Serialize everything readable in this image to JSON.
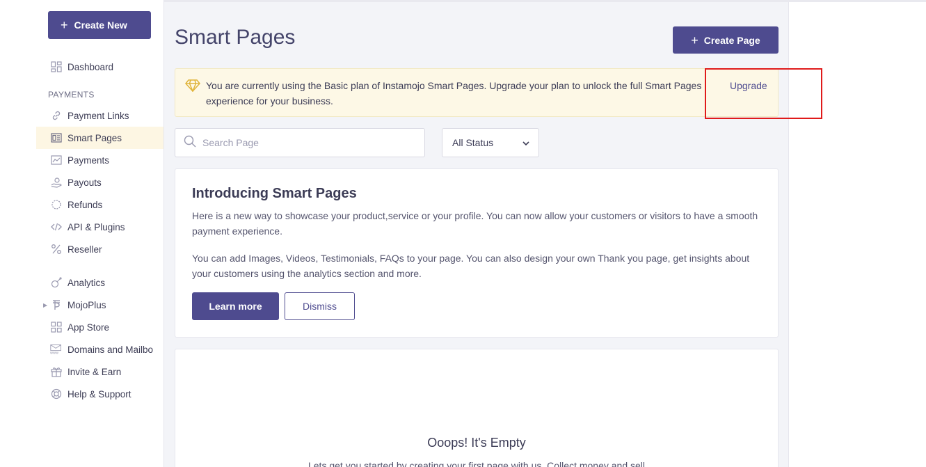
{
  "sidebar": {
    "create_new": "Create New",
    "section_payments": "PAYMENTS",
    "items": [
      {
        "label": "Dashboard",
        "icon": "grid-icon"
      },
      {
        "label": "Payment Links",
        "icon": "link-icon"
      },
      {
        "label": "Smart Pages",
        "icon": "page-icon",
        "active": true
      },
      {
        "label": "Payments",
        "icon": "chart-icon"
      },
      {
        "label": "Payouts",
        "icon": "payouts-icon"
      },
      {
        "label": "Refunds",
        "icon": "refund-icon"
      },
      {
        "label": "API & Plugins",
        "icon": "code-icon"
      },
      {
        "label": "Reseller",
        "icon": "percent-icon"
      },
      {
        "label": "Analytics",
        "icon": "analytics-icon"
      },
      {
        "label": "MojoPlus",
        "icon": "mojoplus-icon"
      },
      {
        "label": "App Store",
        "icon": "apps-icon"
      },
      {
        "label": "Domains and Mailbo",
        "icon": "mail-icon"
      },
      {
        "label": "Invite & Earn",
        "icon": "gift-icon"
      },
      {
        "label": "Help & Support",
        "icon": "support-icon"
      }
    ]
  },
  "main": {
    "title": "Smart Pages",
    "create_page": "Create Page",
    "banner": {
      "text": "You are currently using the Basic plan of Instamojo Smart Pages. Upgrade your plan to unlock the full Smart Pages experience for your business.",
      "link": "Upgrade"
    },
    "search": {
      "placeholder": "Search Page",
      "value": ""
    },
    "status_filter": {
      "selected": "All Status"
    },
    "intro": {
      "title": "Introducing Smart Pages",
      "p1": "Here is a new way to showcase your product,service or your profile. You can now allow your customers or visitors to have a smooth payment experience.",
      "p2": "You can add Images, Videos, Testimonials, FAQs to your page. You can also design your own Thank you page, get insights about your customers using the analytics section and more.",
      "learn_more": "Learn more",
      "dismiss": "Dismiss"
    },
    "empty": {
      "title": "Ooops! It's Empty",
      "subtitle": "Lets get you started by creating your first page with us. Collect money and sell"
    }
  },
  "colors": {
    "accent": "#4e4b8f",
    "banner_bg": "#fdf8e6",
    "active_bg": "#fdf6e3",
    "highlight": "#e01b1b"
  }
}
